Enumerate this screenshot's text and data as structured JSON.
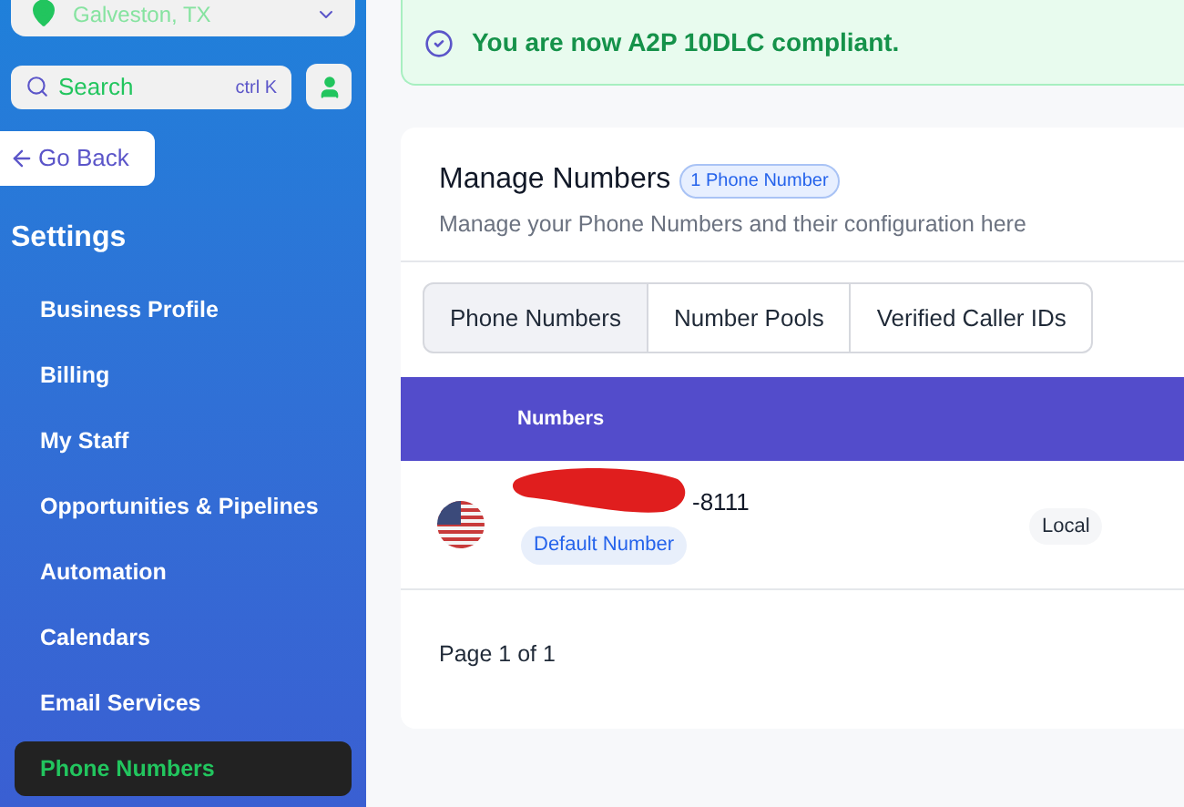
{
  "location": {
    "city": "Galveston, TX"
  },
  "search": {
    "placeholder": "Search",
    "shortcut": "ctrl K"
  },
  "back_button": "Go Back",
  "sidebar": {
    "title": "Settings",
    "items": [
      {
        "label": "Business Profile",
        "selected": false
      },
      {
        "label": "Billing",
        "selected": false
      },
      {
        "label": "My Staff",
        "selected": false
      },
      {
        "label": "Opportunities & Pipelines",
        "selected": false
      },
      {
        "label": "Automation",
        "selected": false
      },
      {
        "label": "Calendars",
        "selected": false
      },
      {
        "label": "Email Services",
        "selected": false
      },
      {
        "label": "Phone Numbers",
        "selected": true
      }
    ]
  },
  "banner": {
    "message": "You are now A2P 10DLC compliant."
  },
  "card": {
    "title": "Manage Numbers",
    "count_badge": "1 Phone Number",
    "description": "Manage your Phone Numbers and their configuration here"
  },
  "tabs": [
    {
      "label": "Phone Numbers",
      "selected": true
    },
    {
      "label": "Number Pools",
      "selected": false
    },
    {
      "label": "Verified Caller IDs",
      "selected": false
    }
  ],
  "table": {
    "columns": [
      "Numbers"
    ],
    "rows": [
      {
        "number": "-8111",
        "tag": "Default Number",
        "type": "Local"
      }
    ]
  },
  "pagination": "Page 1 of 1"
}
